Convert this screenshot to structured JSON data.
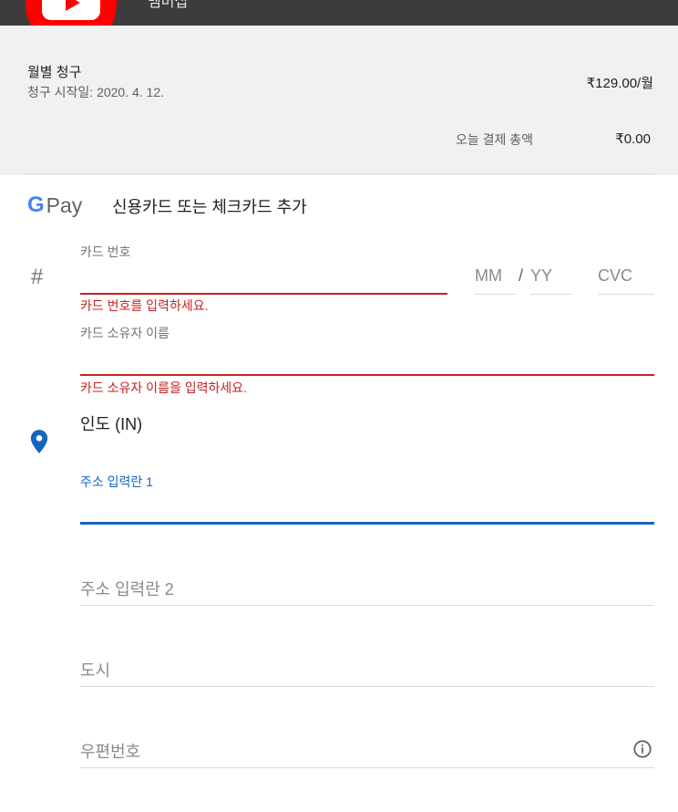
{
  "header": {
    "title": "멤버십"
  },
  "summary": {
    "plan_name": "월별 청구",
    "start_date": "청구 시작일: 2020. 4. 12.",
    "price": "₹129.00/월",
    "today_label": "오늘 결제 총액",
    "today_value": "₹0.00"
  },
  "payment": {
    "gpay_g": "G",
    "gpay_pay": "Pay",
    "title": "신용카드 또는 체크카드 추가"
  },
  "card": {
    "number_label": "카드 번호",
    "number_error": "카드 번호를 입력하세요.",
    "mm_placeholder": "MM",
    "slash": "/",
    "yy_placeholder": "YY",
    "cvc_placeholder": "CVC",
    "holder_label": "카드 소유자 이름",
    "holder_error": "카드 소유자 이름을 입력하세요."
  },
  "address": {
    "country": "인도 (IN)",
    "line1_label": "주소 입력란 1",
    "line2_placeholder": "주소 입력란 2",
    "city_placeholder": "도시",
    "postal_placeholder": "우편번호"
  },
  "icons": {
    "hash": "#",
    "location": "location-pin-icon",
    "info": "info-icon",
    "youtube": "youtube-logo"
  },
  "colors": {
    "error": "#c5221f",
    "active": "#1565c0",
    "youtube_red": "#ff0000"
  }
}
